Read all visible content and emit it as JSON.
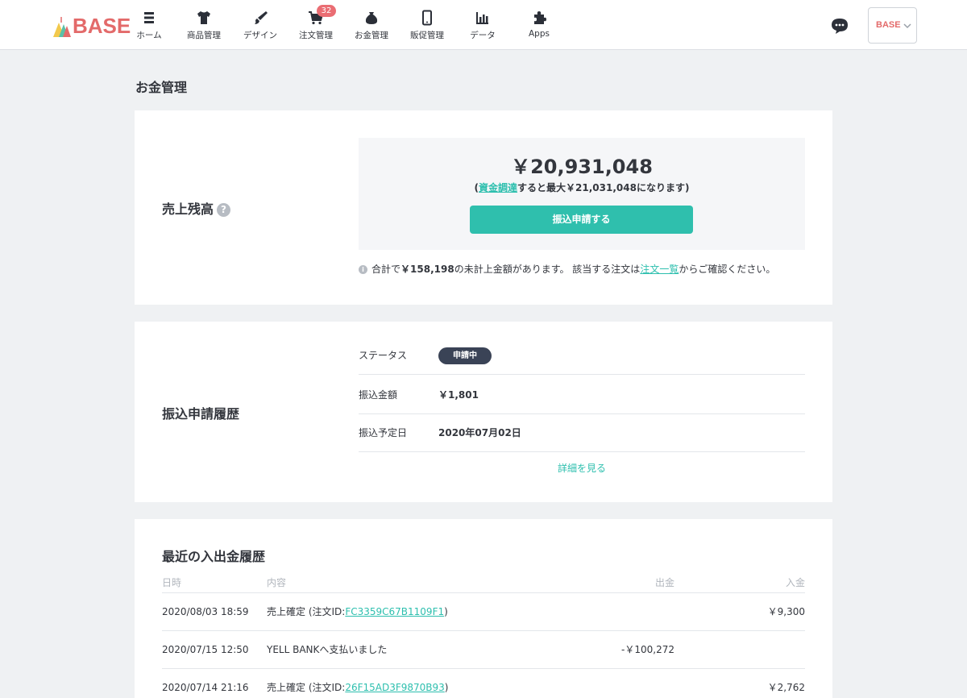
{
  "header": {
    "logo_text": "BASE",
    "nav": [
      {
        "label": "ホーム",
        "icon": "home-list-icon"
      },
      {
        "label": "商品管理",
        "icon": "tshirt-icon"
      },
      {
        "label": "デザイン",
        "icon": "brush-icon"
      },
      {
        "label": "注文管理",
        "icon": "cart-icon"
      },
      {
        "label": "お金管理",
        "icon": "money-bag-icon"
      },
      {
        "label": "販促管理",
        "icon": "phone-icon"
      },
      {
        "label": "データ",
        "icon": "bar-chart-icon"
      },
      {
        "label": "Apps",
        "icon": "puzzle-icon"
      }
    ],
    "order_badge": "32",
    "account_logo_text": "BASE"
  },
  "page_title": "お金管理",
  "balance": {
    "label": "売上残高",
    "help": "?",
    "amount": "￥20,931,048",
    "note_open": "(",
    "note_link": "資金調達",
    "note_rest": "すると最大￥21,031,048になります)",
    "button_label": "振込申請する",
    "info_prefix": "合計で",
    "info_amount": "￥158,198",
    "info_middle": "の未計上金額があります。 該当する注文は",
    "info_link": "注文一覧",
    "info_suffix": "からご確認ください。",
    "info_icon": "i"
  },
  "transfer_history": {
    "label": "振込申請履歴",
    "status_key": "ステータス",
    "status_value": "申請中",
    "amount_key": "振込金額",
    "amount_value": "￥1,801",
    "date_key": "振込予定日",
    "date_value": "2020年07月02日",
    "detail_link": "詳細を見る"
  },
  "recent": {
    "label": "最近の入出金履歴",
    "columns": {
      "date": "日時",
      "desc": "内容",
      "out": "出金",
      "in": "入金"
    },
    "rows": [
      {
        "date": "2020/08/03 18:59",
        "desc_prefix": "売上確定 (注文ID:",
        "order_id": "FC3359C67B1109F1",
        "desc_suffix": ")",
        "out": "",
        "in": "￥9,300"
      },
      {
        "date": "2020/07/15 12:50",
        "desc_prefix": "YELL BANKへ支払いました",
        "order_id": "",
        "desc_suffix": "",
        "out": "-￥100,272",
        "in": ""
      },
      {
        "date": "2020/07/14 21:16",
        "desc_prefix": "売上確定 (注文ID:",
        "order_id": "26F15AD3F9870B93",
        "desc_suffix": ")",
        "out": "",
        "in": "￥2,762"
      }
    ]
  },
  "colors": {
    "accent": "#2fbfad",
    "badge": "#ea6d73",
    "status_pill": "#3a4356"
  }
}
